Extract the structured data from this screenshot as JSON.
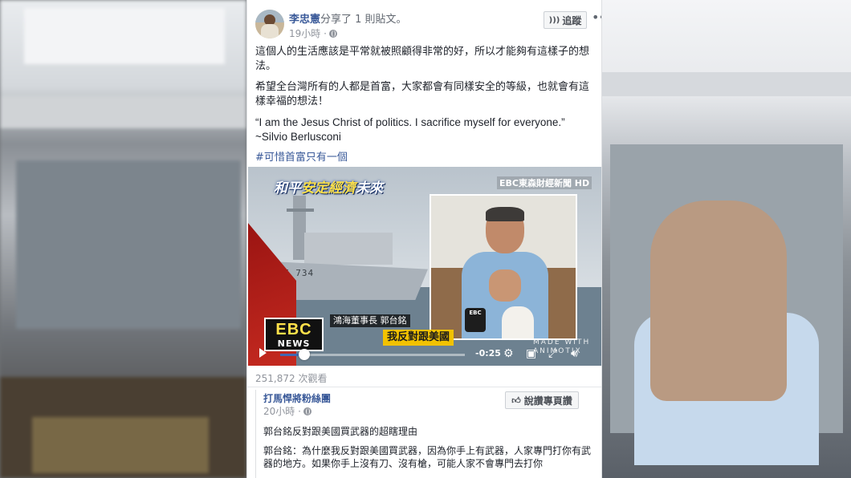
{
  "post": {
    "author": "李忠憲",
    "action": "分享了 1 則貼文。",
    "time": "19小時 ·",
    "follow_label": "追蹤",
    "more_label": "•••",
    "paragraphs": [
      "這個人的生活應該是平常就被照顧得非常的好，所以才能夠有這樣子的想法。",
      "希望全台灣所有的人都是首富，大家都會有同樣安全的等級，也就會有這樣幸福的想法！"
    ],
    "quote": "“I am the Jesus Christ of politics. I sacrifice myself for everyone.”",
    "quote_author": "~Silvio Berlusconi",
    "hashtag": "#可惜首富只有一個"
  },
  "video": {
    "banner_part1": "和平",
    "banner_part2": "安定",
    "banner_part3": "經濟",
    "banner_part4": "未來",
    "channel": "EBC東森財經新聞 HD",
    "ship_number": "F 734",
    "mic_label": "EBC",
    "name_caption": "鴻海董事長 郭台銘",
    "headline": "我反對跟美國",
    "logo_top": "EBC",
    "logo_bottom": "NEWS",
    "watermark": "MADE WITH\nANIMOTIX",
    "time_remaining": "-0:25",
    "progress": 0.13
  },
  "views": "251,872 次觀看",
  "shared": {
    "page_name": "打馬悍將粉絲團",
    "time": "20小時 ·",
    "like_label": "說讚專頁讚",
    "text1": "郭台銘反對跟美國買武器的超瞎理由",
    "text2": "郭台銘：為什麼我反對跟美國買武器，因為你手上有武器，人家專門打你有武器的地方。如果你手上沒有刀、沒有槍，可能人家不會專門去打你"
  },
  "icons": {
    "globe": "globe-icon",
    "rss": "rss-icon",
    "thumb": "thumbs-up-icon",
    "play": "play-icon",
    "settings": "gear-icon",
    "pip": "picture-in-picture-icon",
    "fullscreen": "fullscreen-icon",
    "volume": "volume-icon"
  },
  "colors": {
    "link": "#385898",
    "accent": "#4267b2",
    "caption_yellow": "#f2c200"
  }
}
